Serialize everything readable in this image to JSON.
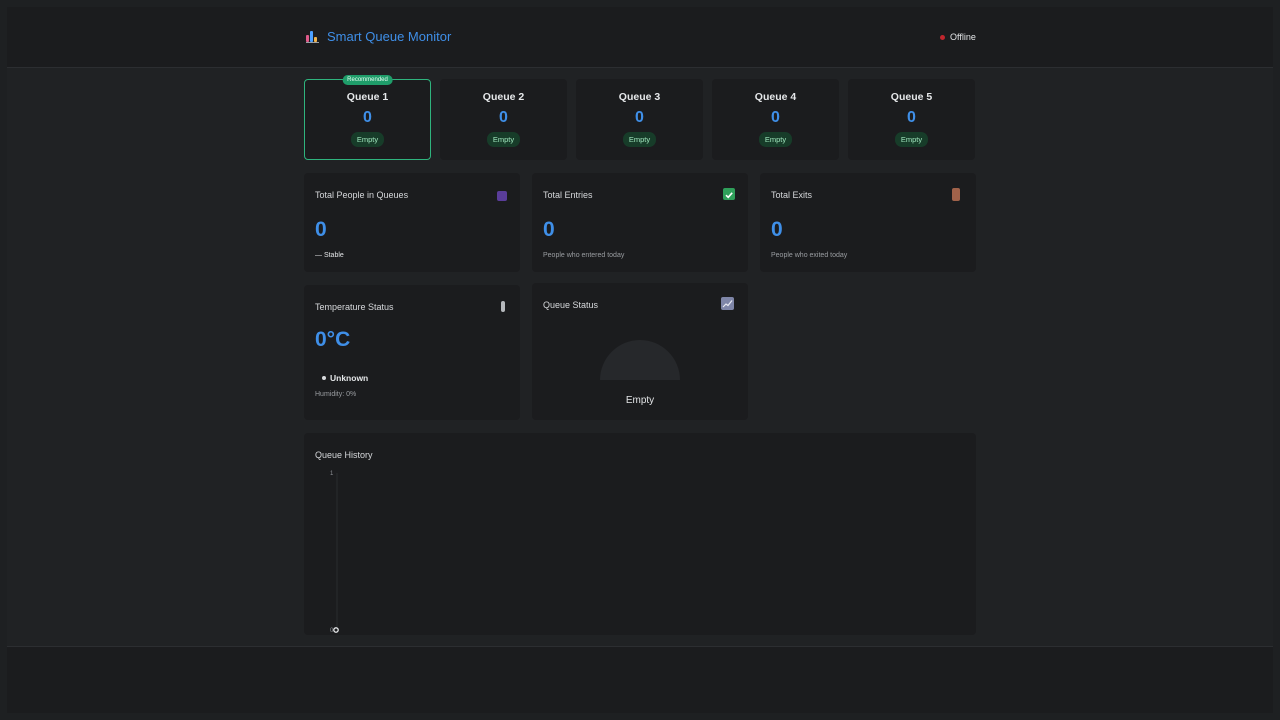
{
  "header": {
    "title": "Smart Queue Monitor",
    "icon": "bar-chart-icon",
    "status_label": "Offline",
    "status_color": "#c0262d"
  },
  "queues": [
    {
      "name": "Queue 1",
      "count": "0",
      "status": "Empty",
      "badge": "Recommended"
    },
    {
      "name": "Queue 2",
      "count": "0",
      "status": "Empty"
    },
    {
      "name": "Queue 3",
      "count": "0",
      "status": "Empty"
    },
    {
      "name": "Queue 4",
      "count": "0",
      "status": "Empty"
    },
    {
      "name": "Queue 5",
      "count": "0",
      "status": "Empty"
    }
  ],
  "stats": {
    "total_people": {
      "title": "Total People in Queues",
      "value": "0",
      "trend": "— Stable",
      "icon": "people-icon"
    },
    "total_entries": {
      "title": "Total Entries",
      "value": "0",
      "sub": "People who entered today",
      "icon": "checkmark-icon"
    },
    "total_exits": {
      "title": "Total Exits",
      "value": "0",
      "sub": "People who exited today",
      "icon": "door-icon"
    }
  },
  "temperature": {
    "title": "Temperature Status",
    "value": "0°C",
    "state": "Unknown",
    "humidity": "Humidity: 0%",
    "icon": "thermometer-icon"
  },
  "queue_status": {
    "title": "Queue Status",
    "label": "Empty",
    "icon": "trend-chart-icon"
  },
  "history": {
    "title": "Queue History"
  },
  "colors": {
    "accent": "#3f8fe8",
    "success": "#2fb47e"
  },
  "chart_data": {
    "type": "line",
    "title": "Queue History",
    "x": [
      0
    ],
    "series": [
      {
        "values": [
          0
        ]
      }
    ],
    "yticks": [
      "1",
      "0"
    ],
    "ylim": [
      0,
      1
    ]
  }
}
